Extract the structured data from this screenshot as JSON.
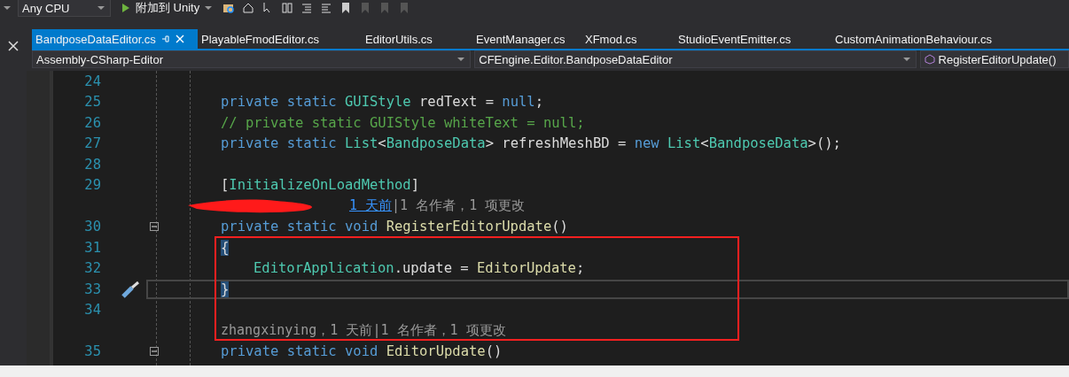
{
  "toolbar": {
    "platform": "Any CPU",
    "run_label": "附加到 Unity"
  },
  "tabs": [
    {
      "label": "BandposeDataEditor.cs",
      "selected": true
    },
    {
      "label": "PlayableFmodEditor.cs",
      "selected": false
    },
    {
      "label": "EditorUtils.cs",
      "selected": false
    },
    {
      "label": "EventManager.cs",
      "selected": false
    },
    {
      "label": "XFmod.cs",
      "selected": false
    },
    {
      "label": "StudioEventEmitter.cs",
      "selected": false
    },
    {
      "label": "CustomAnimationBehaviour.cs",
      "selected": false
    }
  ],
  "nav_bar": {
    "project": "Assembly-CSharp-Editor",
    "type": "CFEngine.Editor.BandposeDataEditor",
    "member": "RegisterEditorUpdate()"
  },
  "lines": [
    {
      "kind": "code",
      "number": "24",
      "current": false,
      "fold": false
    },
    {
      "kind": "code",
      "number": "25",
      "current": false,
      "fold": false,
      "tokens": [
        {
          "text": "private static ",
          "kind": "keyword"
        },
        {
          "text": "GUIStyle",
          "kind": "type"
        },
        {
          "text": " redText = ",
          "kind": "plain"
        },
        {
          "text": "null",
          "kind": "keyword"
        },
        {
          "text": ";",
          "kind": "plain"
        }
      ]
    },
    {
      "kind": "code",
      "number": "26",
      "current": false,
      "fold": false,
      "tokens": [
        {
          "text": "// private static GUIStyle whiteText = null;",
          "kind": "comment"
        }
      ]
    },
    {
      "kind": "code",
      "number": "27",
      "current": false,
      "fold": false,
      "tokens": [
        {
          "text": "private static ",
          "kind": "keyword"
        },
        {
          "text": "List",
          "kind": "type"
        },
        {
          "text": "<",
          "kind": "plain"
        },
        {
          "text": "BandposeData",
          "kind": "type"
        },
        {
          "text": "> refreshMeshBD = ",
          "kind": "plain"
        },
        {
          "text": "new ",
          "kind": "keyword"
        },
        {
          "text": "List",
          "kind": "type"
        },
        {
          "text": "<",
          "kind": "plain"
        },
        {
          "text": "BandposeData",
          "kind": "type"
        },
        {
          "text": ">();",
          "kind": "plain"
        }
      ]
    },
    {
      "kind": "code",
      "number": "28",
      "current": false,
      "fold": false
    },
    {
      "kind": "code",
      "number": "29",
      "current": false,
      "fold": false,
      "tokens": [
        {
          "text": "[",
          "kind": "plain"
        },
        {
          "text": "InitializeOnLoadMethod",
          "kind": "type"
        },
        {
          "text": "]",
          "kind": "plain"
        }
      ]
    },
    {
      "kind": "lens",
      "redacted": true,
      "link": "1 天前",
      "text": "|1 名作者，1 项更改"
    },
    {
      "kind": "code",
      "number": "30",
      "current": false,
      "fold": true,
      "tokens": [
        {
          "text": "private static void ",
          "kind": "keyword"
        },
        {
          "text": "RegisterEditorUpdate",
          "kind": "method"
        },
        {
          "text": "()",
          "kind": "plain"
        }
      ]
    },
    {
      "kind": "code",
      "number": "31",
      "current": false,
      "fold": false,
      "tokens": [
        {
          "text": "{",
          "kind": "brace"
        }
      ]
    },
    {
      "kind": "code",
      "number": "32",
      "current": false,
      "fold": false,
      "indented": true,
      "tokens": [
        {
          "text": "EditorApplication",
          "kind": "type"
        },
        {
          "text": ".update = ",
          "kind": "plain"
        },
        {
          "text": "EditorUpdate",
          "kind": "method"
        },
        {
          "text": ";",
          "kind": "plain"
        }
      ]
    },
    {
      "kind": "code",
      "number": "33",
      "current": true,
      "fold": false,
      "tokens": [
        {
          "text": "}",
          "kind": "brace"
        }
      ]
    },
    {
      "kind": "code",
      "number": "34",
      "current": false,
      "fold": false
    },
    {
      "kind": "lens",
      "redacted": false,
      "text": "zhangxinying，1 天前|1 名作者，1 项更改"
    },
    {
      "kind": "code",
      "number": "35",
      "current": false,
      "fold": true,
      "tokens": [
        {
          "text": "private static void ",
          "kind": "keyword"
        },
        {
          "text": "EditorUpdate",
          "kind": "method"
        },
        {
          "text": "()",
          "kind": "plain"
        }
      ]
    }
  ]
}
